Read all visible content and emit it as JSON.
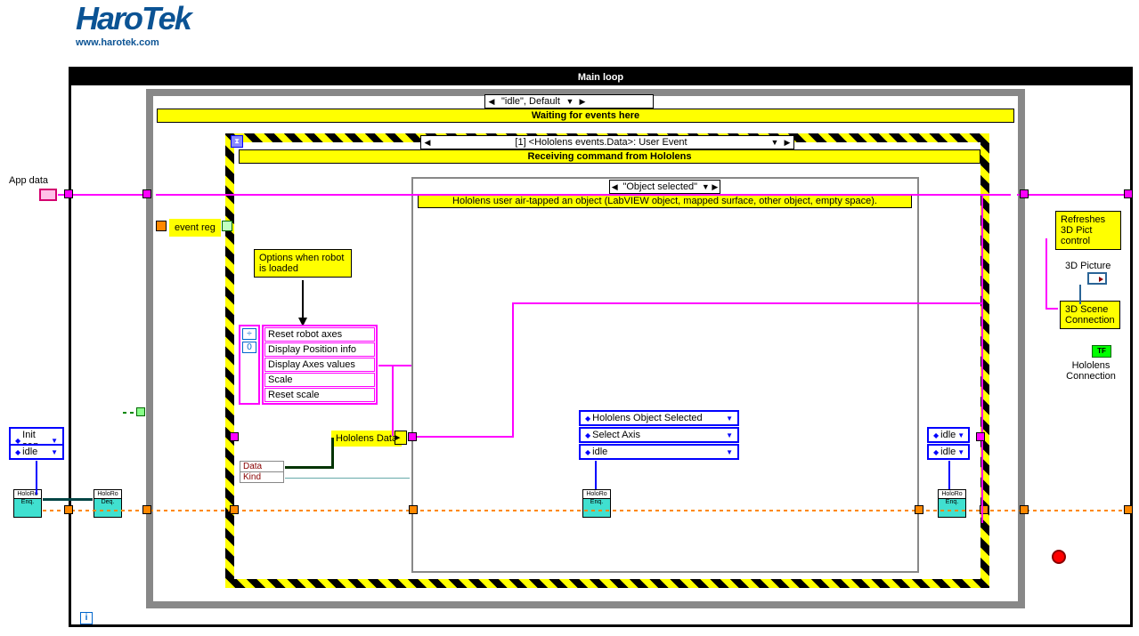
{
  "logo": {
    "name": "HaroTek",
    "url": "www.harotek.com"
  },
  "main_loop_title": "Main loop",
  "outer_case": {
    "selector": "\"idle\", Default",
    "banner": "Waiting for events here"
  },
  "event_struct": {
    "selector": "[1] <Hololens events.Data>: User Event",
    "banner": "Receiving command from Hololens"
  },
  "inner_case": {
    "selector": "\"Object selected\"",
    "banner": "Hololens user air-tapped an object (LabVIEW object, mapped surface, other object, empty space)."
  },
  "app_data_label": "App data",
  "event_reg_label": "event reg",
  "options_note": "Options when robot is loaded",
  "menu_items": [
    "Reset robot axes",
    "Display Position info",
    "Display Axes values",
    "Scale",
    "Reset scale"
  ],
  "hololens_data_label": "Hololens Data",
  "cluster": {
    "row1": "Data",
    "row2": "Kind"
  },
  "center_enums": [
    "Hololens Object Selected",
    "Select Axis",
    "idle"
  ],
  "left_enums": [
    "Init seq",
    "idle"
  ],
  "right_enums": [
    "idle",
    "idle"
  ],
  "refresh_note": "Refreshes 3D Pict control",
  "pic3d_label": "3D Picture",
  "scene3d_note": "3D Scene Connection",
  "hololens_conn_label": "Hololens Connection",
  "vi_labels": {
    "enq": "Enq.",
    "deq": "Deq.",
    "holoro": "HoloRo"
  },
  "idx_zero": "0",
  "iteration_i": "i",
  "tf": "TF"
}
